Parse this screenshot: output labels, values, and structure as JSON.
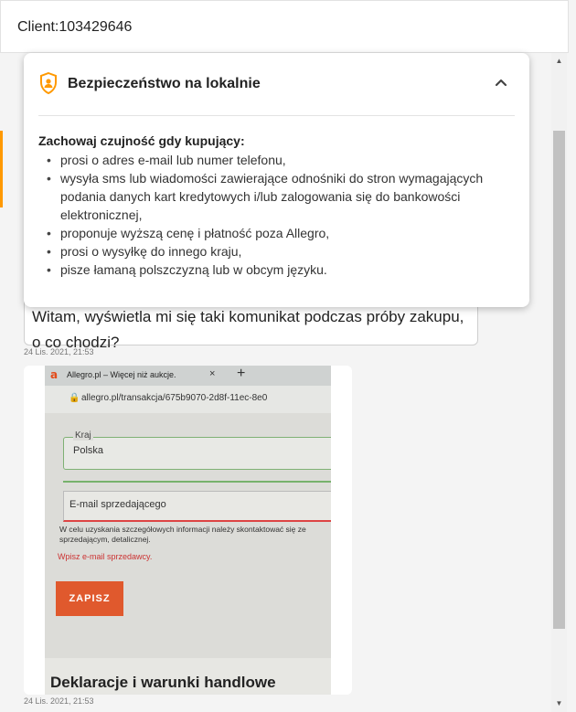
{
  "header": {
    "title": "Client:103429646"
  },
  "popup": {
    "title": "Bezpieczeństwo na lokalnie",
    "shield_icon": "shield-user-icon",
    "collapse_icon": "chevron-up-icon",
    "accent_color": "#ff9900",
    "warning_heading": "Zachowaj czujność gdy kupujący:",
    "warnings": [
      "prosi o adres e-mail lub numer telefonu,",
      "wysyła sms lub wiadomości zawierające odnośniki do stron wymagających podania danych kart kredytowych i/lub zalogowania się do bankowości elektronicznej,",
      "proponuje wyższą cenę i płatność poza Allegro,",
      "prosi o wysyłkę do innego kraju,",
      "pisze łamaną polszczyzną lub w obcym języku."
    ]
  },
  "messages": [
    {
      "text": "Witam, wyświetla mi się taki komunikat podczas próby zakupu, o co chodzi?",
      "timestamp": "24 Lis. 2021, 21:53"
    },
    {
      "type": "image",
      "timestamp": "24 Lis. 2021, 21:53"
    }
  ],
  "photo": {
    "tab_title": "Allegro.pl – Więcej niż aukcje.",
    "tab_close": "×",
    "tab_new": "+",
    "url": "allegro.pl/transakcja/675b9070-2d8f-11ec-8e0",
    "field_country_label": "Kraj",
    "field_country_value": "Polska",
    "field_email_label": "E-mail sprzedającego",
    "help_text": "W celu uzyskania szczegółowych informacji należy skontaktować się ze sprzedającym, detalicznej.",
    "error_text": "Wpisz e-mail sprzedawcy.",
    "save_button": "ZAPISZ",
    "section_title": "Deklaracje i warunki handlowe"
  }
}
